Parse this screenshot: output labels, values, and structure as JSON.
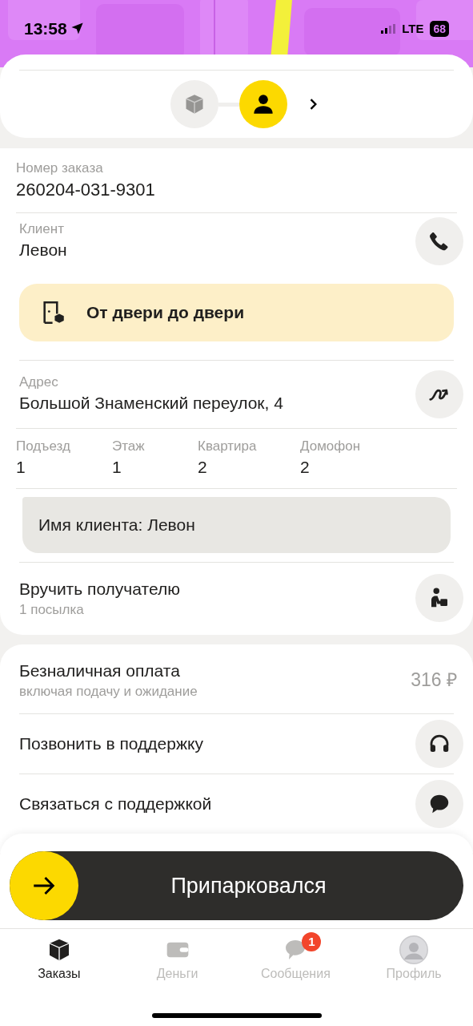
{
  "status_bar": {
    "time": "13:58",
    "network": "LTE",
    "battery": "68"
  },
  "stepper": {
    "steps": [
      {
        "kind": "parcel",
        "selected": false
      },
      {
        "kind": "person",
        "selected": true
      }
    ]
  },
  "order": {
    "label": "Номер заказа",
    "value": "260204-031-9301"
  },
  "client": {
    "label": "Клиент",
    "value": "Левон"
  },
  "delivery_type": "От двери до двери",
  "address": {
    "label": "Адрес",
    "value": "Большой Знаменский переулок, 4"
  },
  "details": [
    {
      "label": "Подъезд",
      "value": "1"
    },
    {
      "label": "Этаж",
      "value": "1"
    },
    {
      "label": "Квартира",
      "value": "2"
    },
    {
      "label": "Домофон",
      "value": "2"
    }
  ],
  "comment": "Имя клиента: Левон",
  "handover": {
    "title": "Вручить получателю",
    "subtitle": "1 посылка"
  },
  "payment": {
    "title": "Безналичная оплата",
    "subtitle": "включая подачу и ожидание",
    "amount": "316 ₽"
  },
  "support_actions": [
    {
      "kind": "call",
      "label": "Позвонить в поддержку"
    },
    {
      "kind": "chat",
      "label": "Связаться с поддержкой"
    }
  ],
  "slider_button": {
    "label": "Припарковался",
    "level": 0
  },
  "tabs": [
    {
      "kind": "orders",
      "label": "Заказы",
      "selected": true
    },
    {
      "kind": "money",
      "label": "Деньги",
      "selected": false
    },
    {
      "kind": "messages",
      "label": "Сообщения",
      "selected": false,
      "badge": "1"
    },
    {
      "kind": "profile",
      "label": "Профиль",
      "selected": false
    }
  ]
}
